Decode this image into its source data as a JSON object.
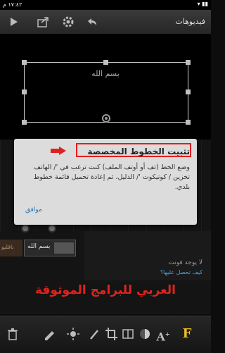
{
  "status_bar": {
    "time": "١٧:٤٢ م",
    "icons": "▾ ▮▮"
  },
  "toolbar": {
    "title": "فيديوهات"
  },
  "canvas": {
    "text": "بسم الله"
  },
  "timeline": {
    "clip_label": "بسم الله",
    "clip0_label": "ناقليو",
    "no_fonts_text": "لا يوجد فونت",
    "how_to_get": "كيف تحصل عليها؟"
  },
  "watermark": "العربي للبرامج الموثوقة",
  "dialog": {
    "title": "تثبيت الخطوط المخصصة",
    "body": "وضع الخط (ثف أو أوتف الملف) كنت ترغب في '/ الهاتف تخزين / كوتيكوت '/ الدليل، ثم إعادة تحميل قائمة خطوط بلدي.",
    "ok": "موافق"
  },
  "bottom_icons": [
    "F",
    "A+",
    "◐",
    "◧",
    "⌗",
    "◑",
    "☀",
    "✎",
    "🗑"
  ],
  "colors": {
    "highlight": "#e02020",
    "link": "#1c6fb5",
    "watermark": "#e0231b"
  }
}
